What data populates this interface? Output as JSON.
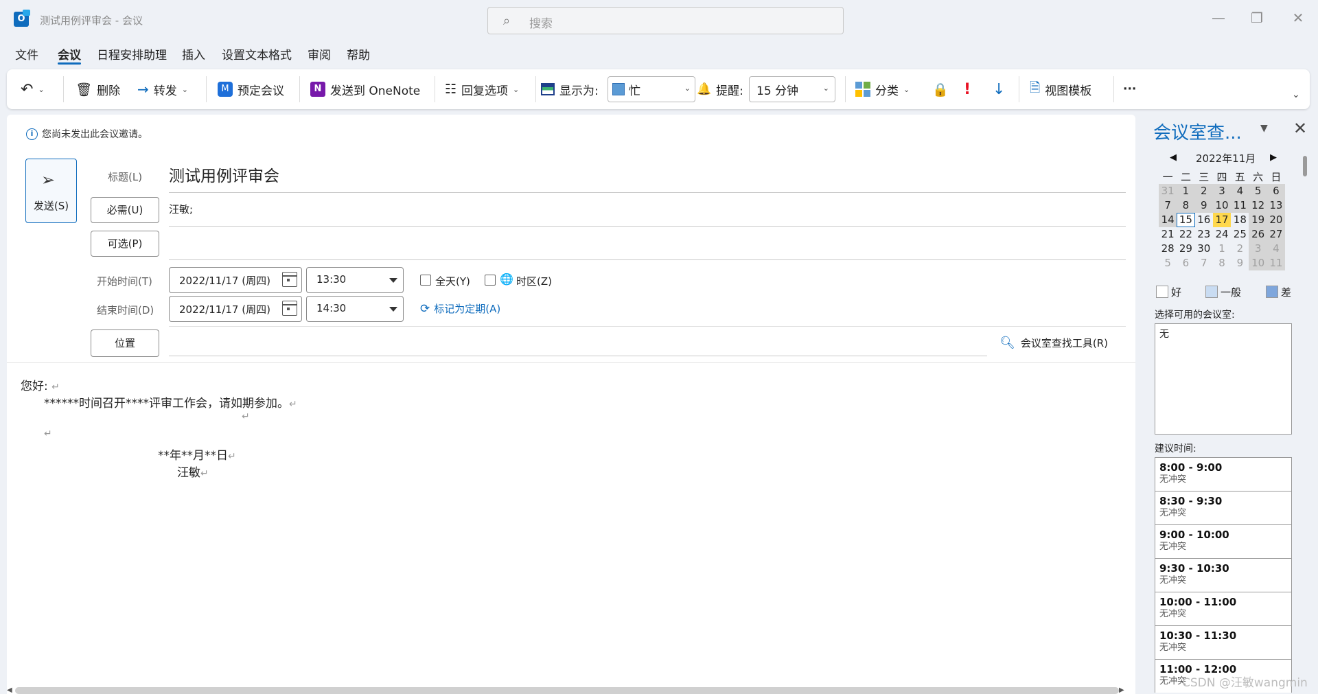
{
  "window": {
    "title": "测试用例评审会  -  会议",
    "search_placeholder": "搜索"
  },
  "menu": [
    "文件",
    "会议",
    "日程安排助理",
    "插入",
    "设置文本格式",
    "审阅",
    "帮助"
  ],
  "ribbon": {
    "delete": "删除",
    "forward": "转发",
    "teams_meeting": "预定会议",
    "onenote": "发送到 OneNote",
    "response_options": "回复选项",
    "show_as_label": "显示为:",
    "show_as_value": "忙",
    "reminder_label": "提醒:",
    "reminder_value": "15 分钟",
    "categorize": "分类",
    "view_templates": "视图模板",
    "more": "···"
  },
  "form": {
    "info": "您尚未发出此会议邀请。",
    "send": "发送(S)",
    "subject_label": "标题(L)",
    "subject": "测试用例评审会",
    "required_btn": "必需(U)",
    "required_value": "汪敏;",
    "optional_btn": "可选(P)",
    "start_label": "开始时间(T)",
    "start_date": "2022/11/17 (周四)",
    "start_time": "13:30",
    "allday": "全天(Y)",
    "timezone": "时区(Z)",
    "end_label": "结束时间(D)",
    "end_date": "2022/11/17 (周四)",
    "end_time": "14:30",
    "recurring": "标记为定期(A)",
    "location_btn": "位置",
    "room_finder": "会议室查找工具(R)"
  },
  "body": {
    "greeting": "您好:",
    "line1": "******时间召开****评审工作会，请如期参加。",
    "date_line": "**年**月**日",
    "signature": "汪敏"
  },
  "pane": {
    "title": "会议室查...",
    "month": "2022年11月",
    "weekdays": [
      "一",
      "二",
      "三",
      "四",
      "五",
      "六",
      "日"
    ],
    "weeks": [
      [
        "31",
        "1",
        "2",
        "3",
        "4",
        "5",
        "6"
      ],
      [
        "7",
        "8",
        "9",
        "10",
        "11",
        "12",
        "13"
      ],
      [
        "14",
        "15",
        "16",
        "17",
        "18",
        "19",
        "20"
      ],
      [
        "21",
        "22",
        "23",
        "24",
        "25",
        "26",
        "27"
      ],
      [
        "28",
        "29",
        "30",
        "1",
        "2",
        "3",
        "4"
      ],
      [
        "5",
        "6",
        "7",
        "8",
        "9",
        "10",
        "11"
      ]
    ],
    "legend": [
      "好",
      "一般",
      "差"
    ],
    "rooms_label": "选择可用的会议室:",
    "rooms_value": "无",
    "suggest_label": "建议时间:",
    "suggestions": [
      {
        "time": "8:00 - 9:00",
        "status": "无冲突"
      },
      {
        "time": "8:30 - 9:30",
        "status": "无冲突"
      },
      {
        "time": "9:00 - 10:00",
        "status": "无冲突"
      },
      {
        "time": "9:30 - 10:30",
        "status": "无冲突"
      },
      {
        "time": "10:00 - 11:00",
        "status": "无冲突"
      },
      {
        "time": "10:30 - 11:30",
        "status": "无冲突"
      },
      {
        "time": "11:00 - 12:00",
        "status": "无冲突"
      }
    ]
  },
  "watermark": "CSDN @汪敏wangmin",
  "colors": {
    "accent": "#0f6cbd",
    "selected_day": "#ffd84d",
    "busy_fill": "#5b9bd5"
  }
}
